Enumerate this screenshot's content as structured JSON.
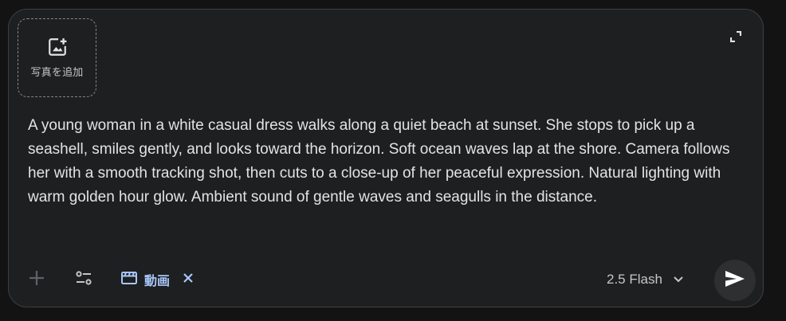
{
  "composer": {
    "add_photo_label": "写真を追加",
    "prompt_text": "A young woman in a white casual dress walks along a quiet beach at sunset. She stops to pick up a seashell, smiles gently, and looks toward the horizon. Soft ocean waves lap at the shore. Camera follows her with a smooth tracking shot, then cuts to a close-up of her peaceful expression. Natural lighting with warm golden hour glow. Ambient sound of gentle waves and seagulls in the distance."
  },
  "toolbar": {
    "video_chip_label": "動画",
    "model_label": "2.5 Flash"
  },
  "icons": {
    "add_photo": "add-photo-icon",
    "expand": "expand-icon",
    "plus": "plus-icon",
    "tools": "tools-icon",
    "video": "clapperboard-icon",
    "remove": "close-icon",
    "dropdown": "chevron-down-icon",
    "send": "send-icon"
  },
  "colors": {
    "background": "#131314",
    "surface": "#1e1f20",
    "text": "#e3e3e3",
    "accent": "#a8c7fa",
    "muted": "#c4c7c5"
  }
}
